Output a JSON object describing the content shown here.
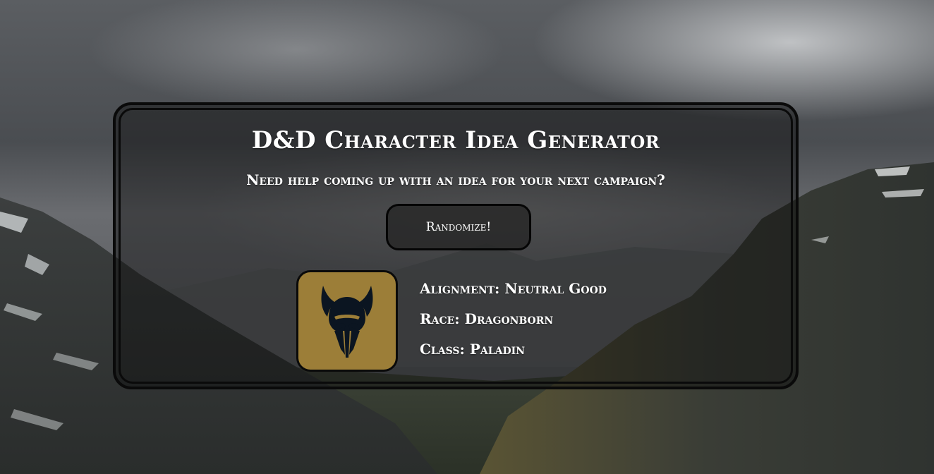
{
  "page": {
    "title": "D&D Character Idea Generator",
    "subtitle": "Need help coming up with an idea for your next campaign?"
  },
  "actions": {
    "randomize_label": "Randomize!"
  },
  "character": {
    "icon": "paladin-helmet-icon",
    "alignment_label": "Alignment:",
    "alignment_value": "Neutral Good",
    "race_label": "Race:",
    "race_value": "Dragonborn",
    "class_label": "Class:",
    "class_value": "Paladin"
  },
  "colors": {
    "icon_background": "#9c7e38",
    "panel_border": "#0a0a0a",
    "text": "#ffffff"
  }
}
